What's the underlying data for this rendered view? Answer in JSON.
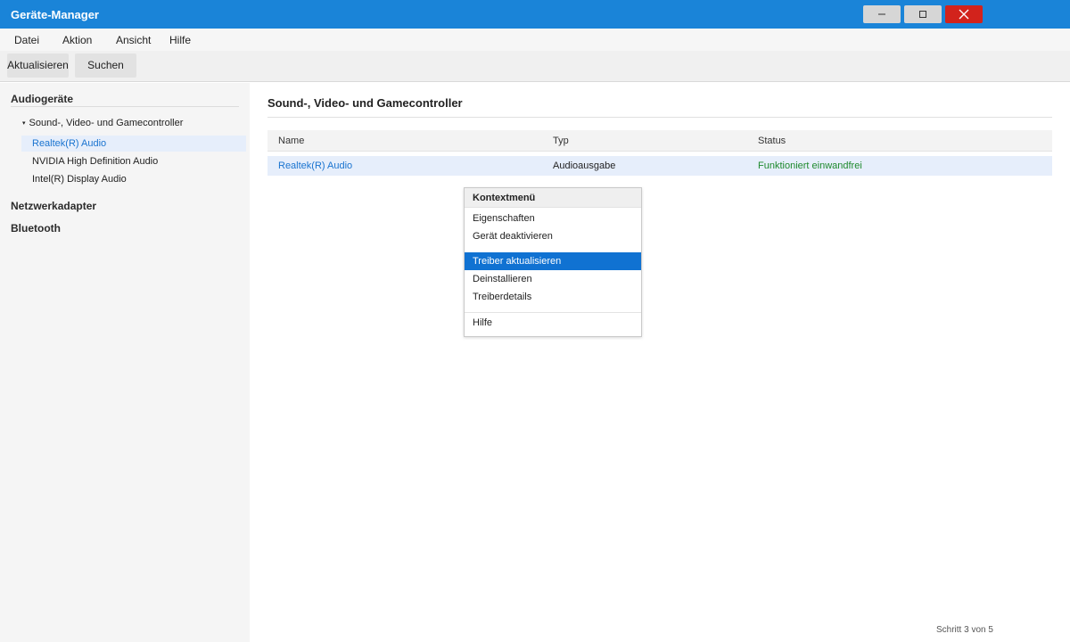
{
  "window": {
    "title": "Geräte-Manager"
  },
  "menubar": {
    "items": [
      "Datei",
      "Aktion",
      "Ansicht",
      "Hilfe"
    ]
  },
  "toolbar": {
    "refresh_label": "Aktualisieren",
    "search_label": "Suchen"
  },
  "sidebar": {
    "sections": [
      {
        "title": "Audiogeräte",
        "group": "Sound-, Video- und Gamecontroller",
        "items": [
          "Realtek(R) Audio",
          "NVIDIA High Definition Audio",
          "Intel(R) Display Audio"
        ],
        "selected_index": 0
      },
      {
        "title": "Netzwerkadapter"
      },
      {
        "title": "Bluetooth"
      }
    ]
  },
  "content": {
    "title": "Sound-, Video- und Gamecontroller",
    "columns": [
      "Name",
      "Typ",
      "Status"
    ],
    "rows": [
      {
        "name": "Realtek(R) Audio",
        "type": "Audioausgabe",
        "status": "Funktioniert einwandfrei"
      }
    ]
  },
  "context_menu": {
    "title": "Kontextmenü",
    "groups": [
      [
        "Eigenschaften",
        "Gerät deaktivieren"
      ],
      [
        "Treiber aktualisieren",
        "Deinstallieren",
        "Treiberdetails"
      ],
      [
        "Hilfe"
      ]
    ],
    "highlighted": "Treiber aktualisieren"
  },
  "footer": {
    "step_text": "Schritt 3 von 5"
  },
  "colors": {
    "accent": "#1a84d8",
    "selection": "#1072d2",
    "status_ok": "#1f8a2e",
    "close_button": "#d2231c"
  }
}
